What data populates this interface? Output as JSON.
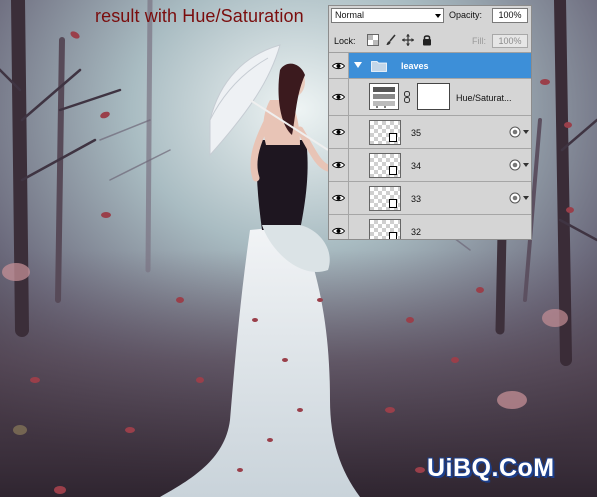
{
  "caption": "result with Hue/Saturation",
  "layers_panel": {
    "blend_mode": "Normal",
    "opacity_label": "Opacity:",
    "opacity_value": "100%",
    "lock_label": "Lock:",
    "lock_icons": [
      "lock-transparent-pixels-icon",
      "lock-image-pixels-icon",
      "lock-position-icon",
      "lock-all-icon"
    ],
    "fill_label": "Fill:",
    "fill_value": "100%",
    "group": {
      "name": "leaves",
      "expanded": true,
      "selected": true,
      "visible": true
    },
    "adjustment_layer": {
      "name": "Hue/Saturat...",
      "visible": true,
      "has_mask": true
    },
    "layers": [
      {
        "name": "35",
        "visible": true,
        "type": "smart-object",
        "has_effects": true
      },
      {
        "name": "34",
        "visible": true,
        "type": "smart-object",
        "has_effects": true
      },
      {
        "name": "33",
        "visible": true,
        "type": "smart-object",
        "has_effects": true
      },
      {
        "name": "32",
        "visible": true,
        "type": "smart-object",
        "has_effects": false
      }
    ],
    "colors": {
      "selected_row": "#3d8fd8",
      "panel_bg": "#d5d5d5"
    }
  },
  "watermark": "UiBQ.CoM",
  "colors": {
    "caption": "#7a0d0d",
    "watermark_outline": "#1b3f8c"
  }
}
